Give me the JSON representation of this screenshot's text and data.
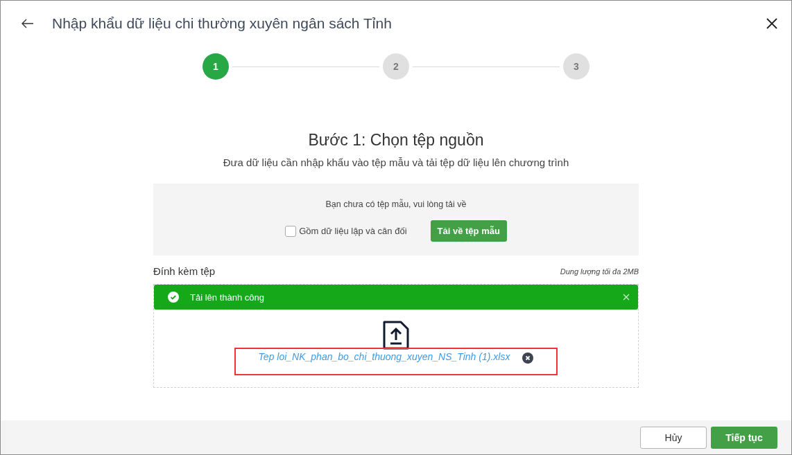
{
  "window": {
    "title": "Nhập khẩu dữ liệu chi thường xuyên ngân sách Tỉnh"
  },
  "steps": [
    {
      "label": "1",
      "selected": true
    },
    {
      "label": "2",
      "selected": false
    },
    {
      "label": "3",
      "selected": false
    }
  ],
  "heading": "Bước 1: Chọn tệp nguồn",
  "subtitle": "Đưa dữ liệu cần nhập khẩu vào tệp mẫu và tải tệp dữ liệu lên chương trình",
  "template_box": {
    "message": "Bạn chưa có tệp mẫu, vui lòng tải về",
    "checkbox": {
      "label": "Gồm dữ liệu lập và cân đối",
      "checked": false
    },
    "button": "Tải về tệp mẫu"
  },
  "attachment": {
    "label": "Đính kèm tệp",
    "size_note": "Dung lượng tối đa 2MB",
    "banner": "Tải lên thành công",
    "file_name": "Tep loi_NK_phan_bo_chi_thuong_xuyen_NS_Tinh (1).xlsx",
    "highlighted": true
  },
  "footer": {
    "buttons": [
      {
        "label": "Hủy",
        "kind": "secondary"
      },
      {
        "label": "Tiếp tục",
        "kind": "primary"
      }
    ]
  }
}
